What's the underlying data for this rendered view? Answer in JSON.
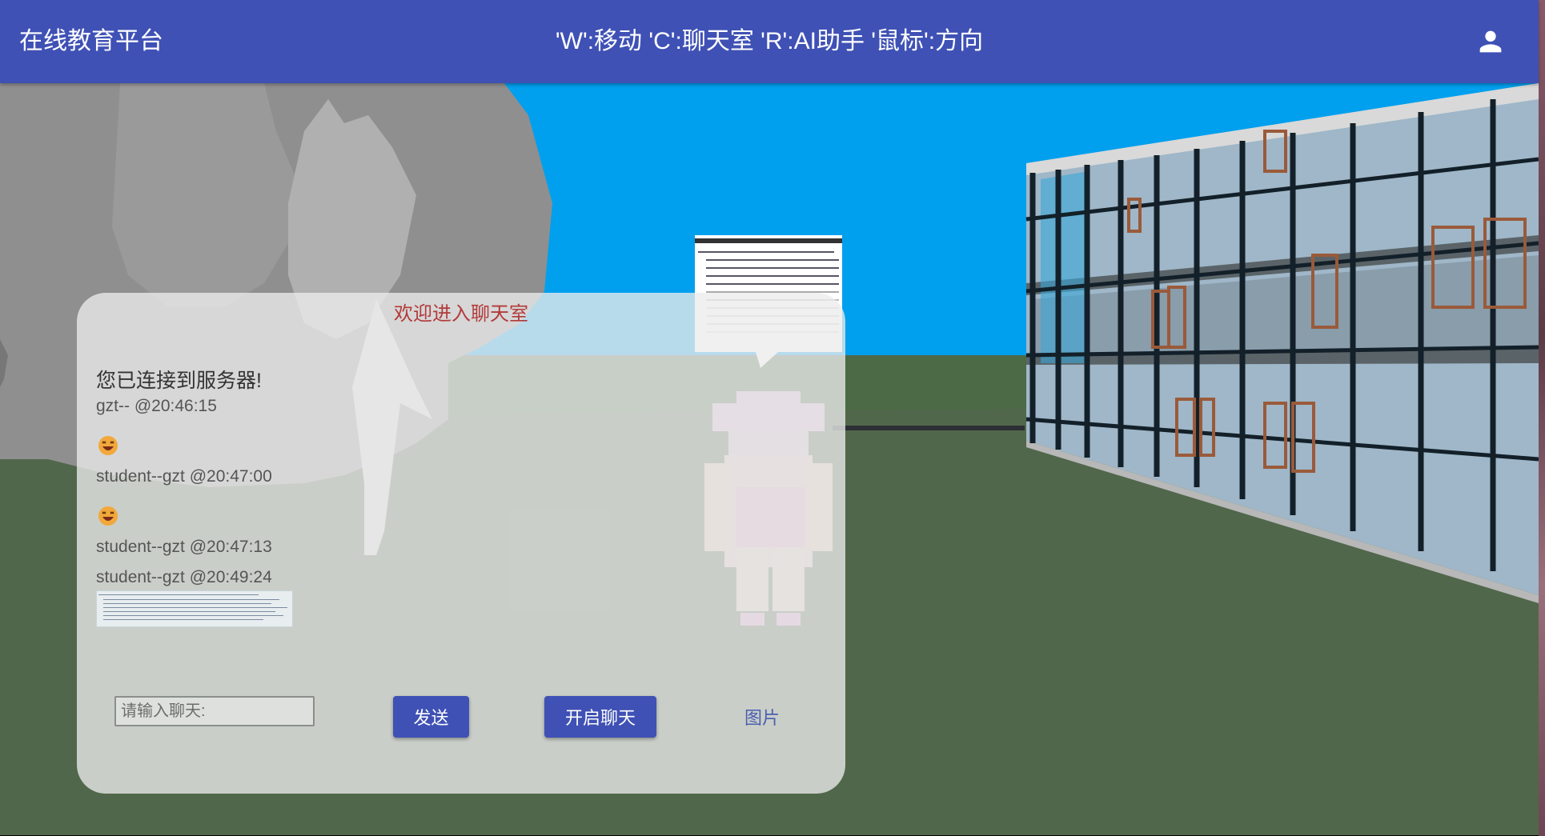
{
  "appbar": {
    "title": "在线教育平台",
    "hint": "'W':移动 'C':聊天室 'R':AI助手 '鼠标':方向",
    "user_icon": "account-icon",
    "color": "#3f51b5"
  },
  "chat": {
    "title": "欢迎进入聊天室",
    "messages": [
      {
        "type": "text",
        "content": "您已连接到服务器!",
        "meta": "gzt-- @20:46:15"
      },
      {
        "type": "emoji",
        "content": "laughing-emoji",
        "meta": "student--gzt @20:47:00"
      },
      {
        "type": "emoji",
        "content": "laughing-emoji",
        "meta": "student--gzt @20:47:13"
      },
      {
        "type": "image",
        "content": "screenshot-image",
        "meta": "student--gzt @20:49:24"
      }
    ],
    "input": {
      "placeholder": "请输入聊天:",
      "value": ""
    },
    "send_label": "发送",
    "open_chat_label": "开启聊天",
    "image_label": "图片",
    "title_color": "#b23a3a"
  },
  "scene": {
    "sky_color": "#00a0ee",
    "ground_color": "#51674b"
  }
}
